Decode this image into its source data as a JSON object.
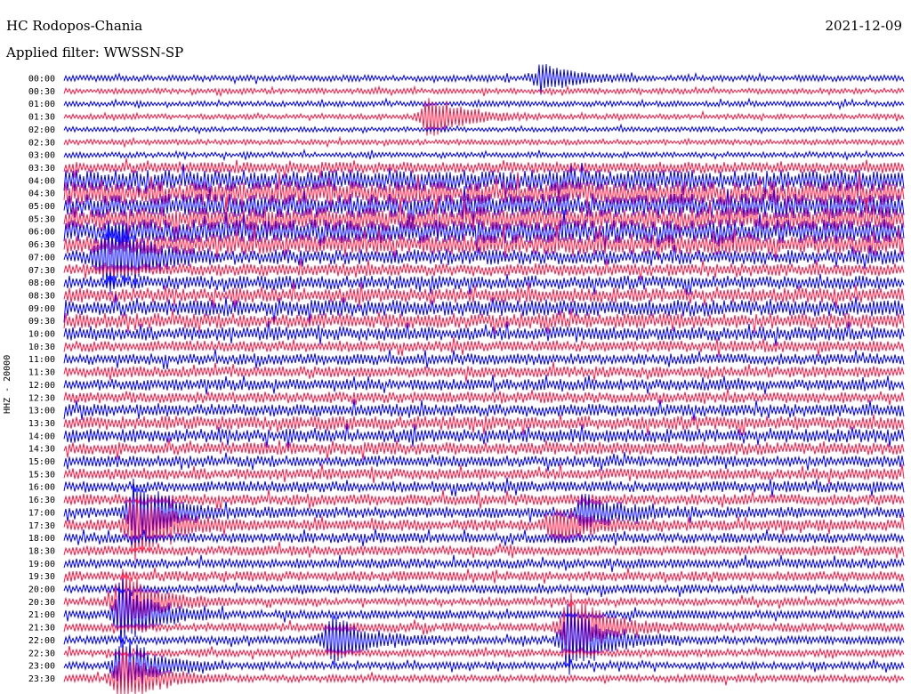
{
  "header": {
    "station": "HC Rodopos-Chania",
    "date": "2021-12-09",
    "filter": "Applied filter: WWSSN-SP"
  },
  "channel_label": "HHZ - 20000",
  "colors": {
    "trace_even": "#0000ff",
    "trace_odd": "#ff1744",
    "background": "#ffffff",
    "text": "#000000"
  },
  "chart_data": {
    "type": "line",
    "title": "HC Rodopos-Chania",
    "subtitle": "Applied filter: WWSSN-SP",
    "date": "2021-12-09",
    "ylabel": "HHZ - 20000",
    "row_labels": [
      "00:00",
      "00:30",
      "01:00",
      "01:30",
      "02:00",
      "02:30",
      "03:00",
      "03:30",
      "04:00",
      "04:30",
      "05:00",
      "05:30",
      "06:00",
      "06:30",
      "07:00",
      "07:30",
      "08:00",
      "08:30",
      "09:00",
      "09:30",
      "10:00",
      "10:30",
      "11:00",
      "11:30",
      "12:00",
      "12:30",
      "13:00",
      "13:30",
      "14:00",
      "14:30",
      "15:00",
      "15:30",
      "16:00",
      "16:30",
      "17:00",
      "17:30",
      "18:00",
      "18:30",
      "19:00",
      "19:30",
      "20:00",
      "20:30",
      "21:00",
      "21:30",
      "22:00",
      "22:30",
      "23:00",
      "23:30"
    ],
    "row_noise_level": [
      0.25,
      0.22,
      0.22,
      0.22,
      0.2,
      0.22,
      0.22,
      0.45,
      0.85,
      0.95,
      0.95,
      0.95,
      0.95,
      0.8,
      0.6,
      0.5,
      0.55,
      0.6,
      0.65,
      0.6,
      0.55,
      0.45,
      0.45,
      0.45,
      0.45,
      0.45,
      0.5,
      0.55,
      0.55,
      0.5,
      0.45,
      0.45,
      0.45,
      0.45,
      0.45,
      0.45,
      0.4,
      0.4,
      0.4,
      0.4,
      0.35,
      0.3,
      0.35,
      0.35,
      0.35,
      0.3,
      0.3,
      0.3
    ],
    "events": [
      {
        "row": 0,
        "minute": 17,
        "amplitude": 1.2
      },
      {
        "row": 3,
        "minute": 13,
        "amplitude": 2.0
      },
      {
        "row": 14,
        "minute": 1.5,
        "amplitude": 3.5
      },
      {
        "row": 34,
        "minute": 2.5,
        "amplitude": 3.0
      },
      {
        "row": 35,
        "minute": 2.5,
        "amplitude": 2.8
      },
      {
        "row": 34,
        "minute": 18.5,
        "amplitude": 1.5
      },
      {
        "row": 35,
        "minute": 17.5,
        "amplitude": 1.6
      },
      {
        "row": 41,
        "minute": 2,
        "amplitude": 2.8
      },
      {
        "row": 42,
        "minute": 2,
        "amplitude": 2.8
      },
      {
        "row": 44,
        "minute": 9.5,
        "amplitude": 2.2
      },
      {
        "row": 43,
        "minute": 18,
        "amplitude": 3.0
      },
      {
        "row": 44,
        "minute": 18,
        "amplitude": 3.0
      },
      {
        "row": 46,
        "minute": 2,
        "amplitude": 2.5
      },
      {
        "row": 47,
        "minute": 2,
        "amplitude": 2.5
      }
    ]
  }
}
